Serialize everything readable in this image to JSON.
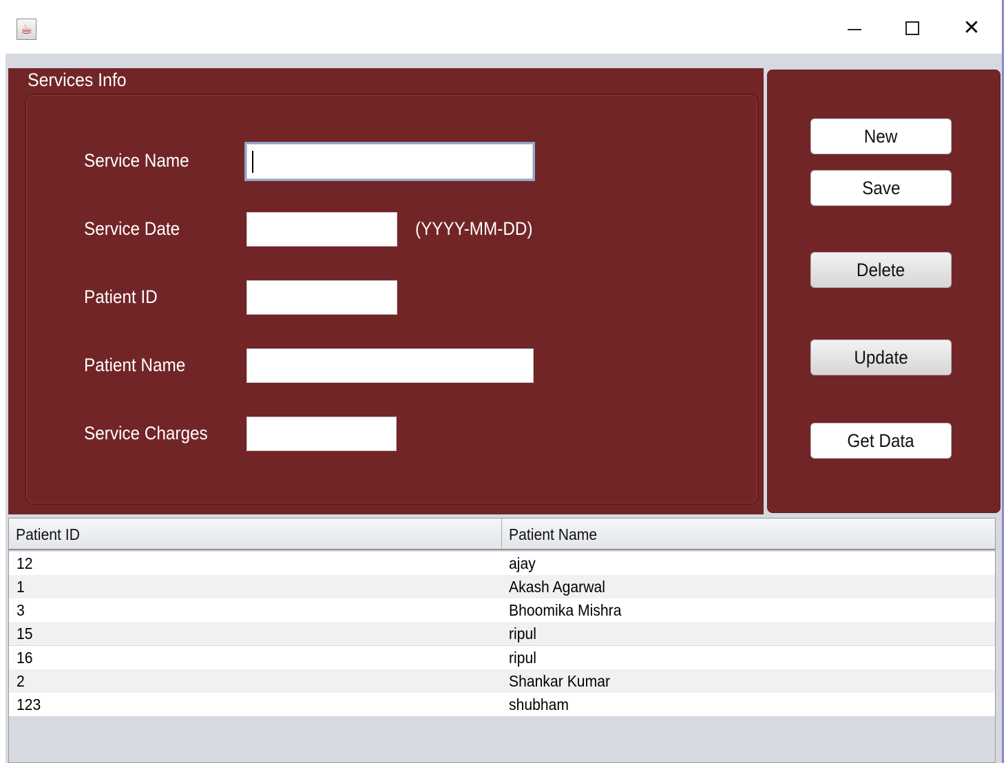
{
  "window": {
    "icon": "java-coffee-icon",
    "controls": [
      "minimize-icon",
      "maximize-icon",
      "close-icon"
    ],
    "close_glyph": "✕"
  },
  "services_panel": {
    "title": "Services Info",
    "fields": {
      "service_name": {
        "label": "Service Name",
        "value": ""
      },
      "service_date": {
        "label": "Service Date",
        "value": "",
        "hint": "(YYYY-MM-DD)"
      },
      "patient_id": {
        "label": "Patient ID",
        "value": ""
      },
      "patient_name": {
        "label": "Patient Name",
        "value": ""
      },
      "service_charges": {
        "label": "Service Charges",
        "value": ""
      }
    }
  },
  "buttons": {
    "new": "New",
    "save": "Save",
    "delete": "Delete",
    "update": "Update",
    "get_data": "Get Data"
  },
  "table": {
    "columns": [
      "Patient ID",
      "Patient Name"
    ],
    "rows": [
      [
        "12",
        "ajay"
      ],
      [
        "1",
        "Akash Agarwal"
      ],
      [
        "3",
        "Bhoomika Mishra"
      ],
      [
        "15",
        "ripul"
      ],
      [
        "16",
        "ripul"
      ],
      [
        "2",
        "Shankar Kumar"
      ],
      [
        "123",
        "shubham"
      ]
    ]
  },
  "colors": {
    "panel_bg": "#722527",
    "window_bg": "#d6d9df",
    "focus_border": "#8fa6c8"
  }
}
